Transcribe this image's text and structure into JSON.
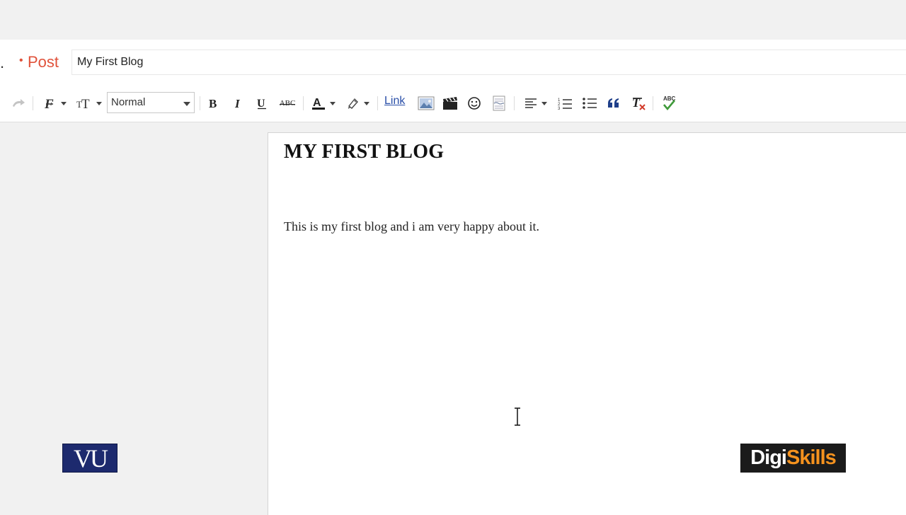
{
  "header": {
    "truncated_text": ".",
    "post_label": "Post",
    "title_value": "My First Blog"
  },
  "toolbar": {
    "format_value": "Normal",
    "link_label": "Link",
    "strikethrough_label": "ABC",
    "spellcheck_label": "ABC",
    "icons": [
      "redo-icon",
      "font-family-icon",
      "font-size-icon",
      "bold-icon",
      "italic-icon",
      "underline-icon",
      "strikethrough-icon",
      "text-color-icon",
      "highlight-icon",
      "image-icon",
      "video-icon",
      "emoji-icon",
      "jump-break-icon",
      "align-icon",
      "numbered-list-icon",
      "bulleted-list-icon",
      "quote-icon",
      "clear-formatting-icon",
      "spellcheck-icon"
    ],
    "accent_red": "#e0523b",
    "link_color": "#2a4fa8"
  },
  "editor": {
    "heading": "MY FIRST BLOG",
    "body": "This is my first blog and i am very happy about it."
  },
  "watermarks": {
    "left_logo": "VU",
    "right_logo_part1": "Digi",
    "right_logo_part2": "Skills"
  }
}
